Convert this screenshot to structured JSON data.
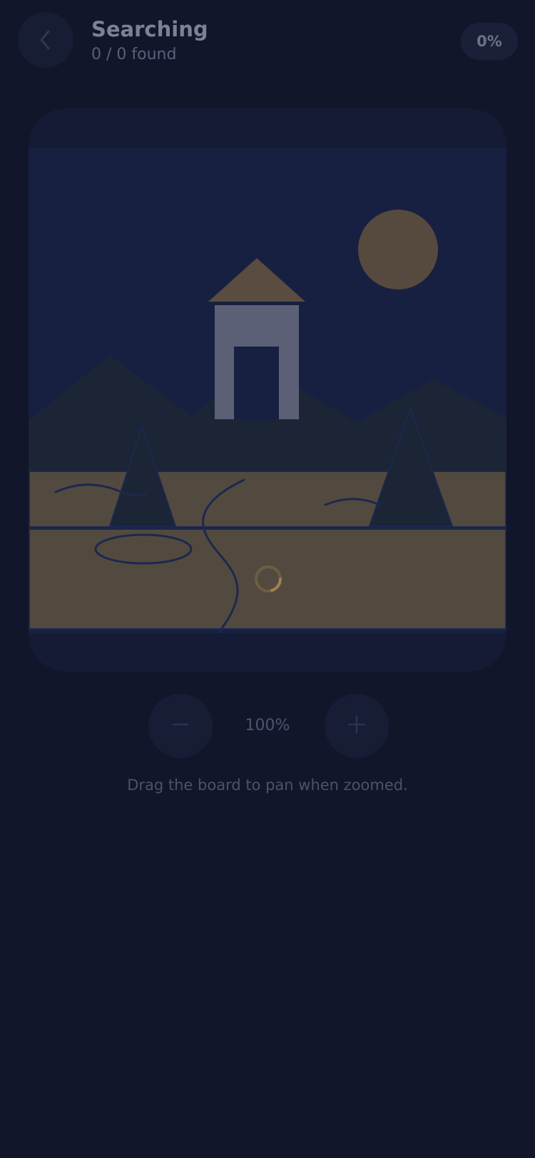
{
  "header": {
    "back_icon": "chevron-left-icon",
    "title": "Searching",
    "subtitle": "0 / 0 found",
    "progress": "0%"
  },
  "board": {
    "loading_icon": "spinner-icon",
    "colors": {
      "sky": "#172040",
      "mountains": "#1b2536",
      "ground": "#534a3f",
      "sun": "#564a3f",
      "roof": "#5a4c40",
      "tower": "#5c6077",
      "lines": "#1d2850",
      "spinner": "#a0804f"
    }
  },
  "zoom": {
    "out_icon": "minus-icon",
    "in_icon": "plus-icon",
    "level": "100%"
  },
  "hint": "Drag the board to pan when zoomed."
}
